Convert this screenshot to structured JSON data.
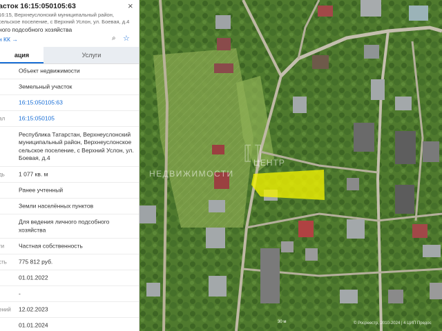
{
  "panel": {
    "title": "асток 16:15:050105:63",
    "close_icon": "close-icon",
    "address_line1": "16:15, Верхнеуслонский муниципальный район,",
    "address_line2": "сельское поселение, с Верхний Услон, ул. Боевая, д.4",
    "description": "ного подсобного хозяйства",
    "link": "н КК →",
    "icons": [
      "zoom-to-object-icon",
      "star-icon"
    ]
  },
  "tabs": [
    {
      "label": "ация",
      "active": true
    },
    {
      "label": "Услуги",
      "active": false
    }
  ],
  "rows": [
    {
      "label": "",
      "value": "Объект недвижимости"
    },
    {
      "label": "",
      "value": "Земельный участок"
    },
    {
      "label": "",
      "value": "16:15:050105:63",
      "link": true
    },
    {
      "label": "ал",
      "value": "16:15:050105",
      "link": true
    },
    {
      "label": "",
      "value": "Республика Татарстан, Верхнеуслонский муниципальный район, Верхнеуслонское сельское поселение, с Верхний Услон, ул. Боевая, д.4"
    },
    {
      "label": "дь",
      "value": "1 077 кв. м"
    },
    {
      "label": "",
      "value": "Ранее учтенный"
    },
    {
      "label": "",
      "value": "Земли населённых пунктов"
    },
    {
      "label": "",
      "value": "Для ведения личного подсобного хозяйства"
    },
    {
      "label": "ти",
      "value": "Частная собственность"
    },
    {
      "label": "сть",
      "value": "775 812 руб."
    },
    {
      "label": "",
      "value": "01.01.2022"
    },
    {
      "label": "",
      "value": "-"
    },
    {
      "label": "ений",
      "value": "12.02.2023"
    },
    {
      "label": "",
      "value": "01.01.2024"
    }
  ],
  "map": {
    "watermark_line1": "ЦЕНТР",
    "watermark_line2": "НЕДВИЖИМОСТИ",
    "copyright": "© Росреестр, 2010-2024 | 4 ЦИП Предос",
    "scale_label": "30 м",
    "parcel_color": "#f2f200"
  }
}
